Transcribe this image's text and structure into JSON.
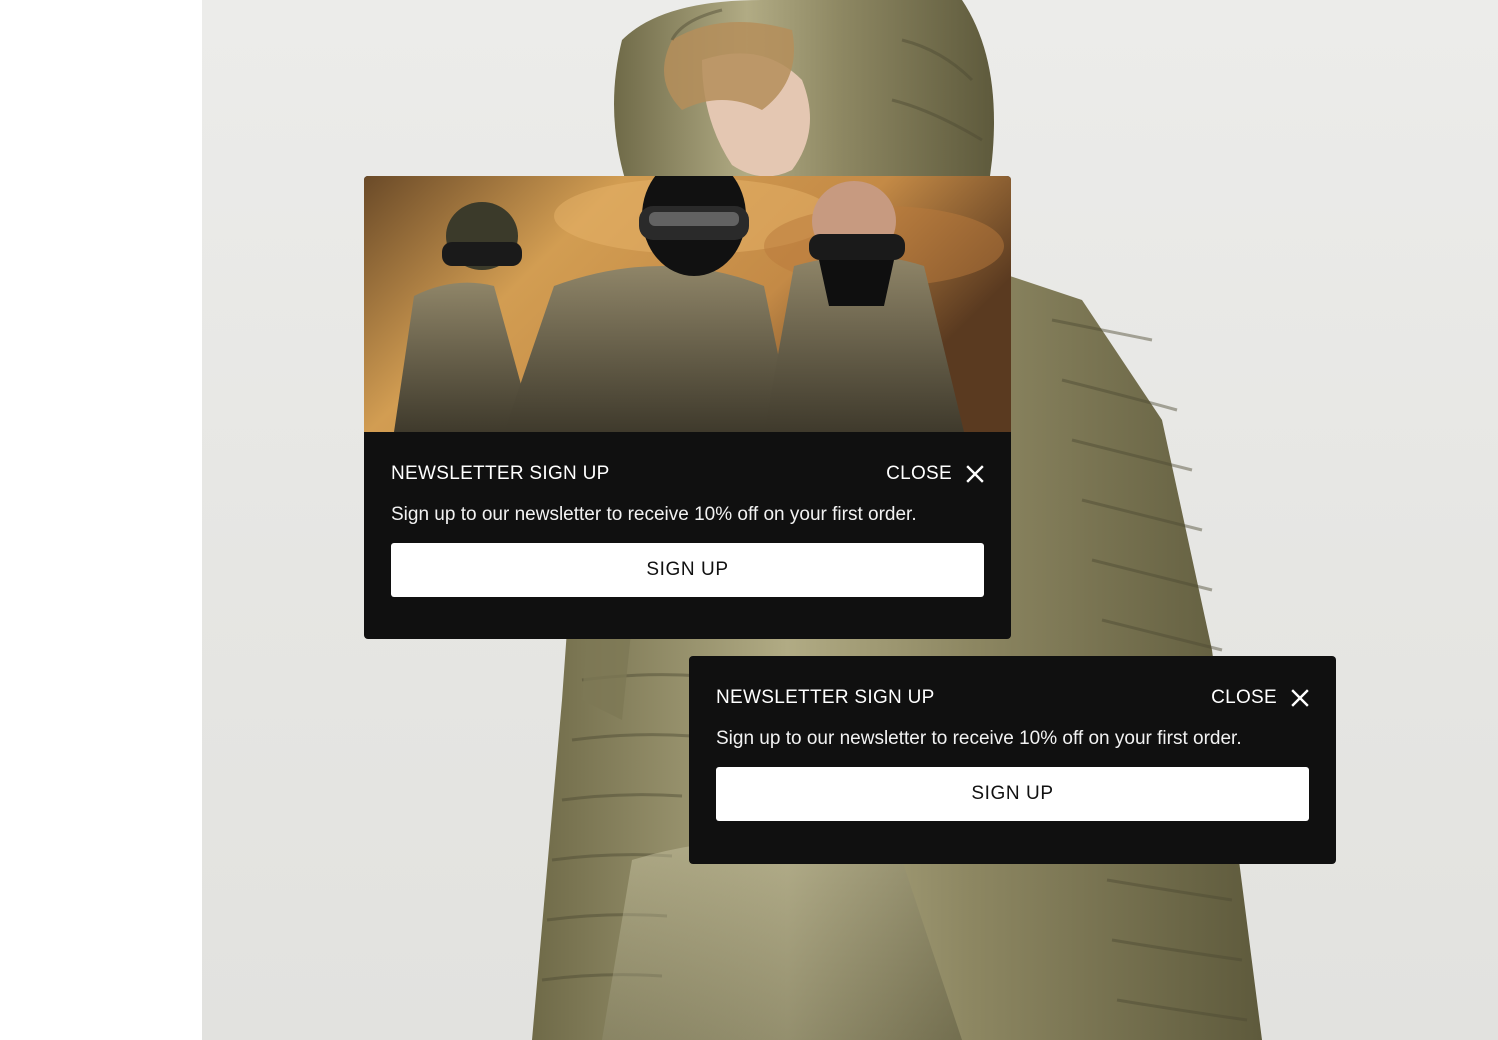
{
  "popups": [
    {
      "title": "NEWSLETTER SIGN UP",
      "close_label": "CLOSE",
      "description": "Sign up to our newsletter to receive 10% off on your first order.",
      "cta_label": "SIGN UP",
      "has_image": true
    },
    {
      "title": "NEWSLETTER SIGN UP",
      "close_label": "CLOSE",
      "description": "Sign up to our newsletter to receive 10% off on your first order.",
      "cta_label": "SIGN UP",
      "has_image": false
    }
  ],
  "colors": {
    "popup_bg": "#101010",
    "cta_bg": "#ffffff",
    "jacket": "#8a8460",
    "sky_warm": "#d9a25a"
  },
  "icons": {
    "close": "close-icon"
  }
}
